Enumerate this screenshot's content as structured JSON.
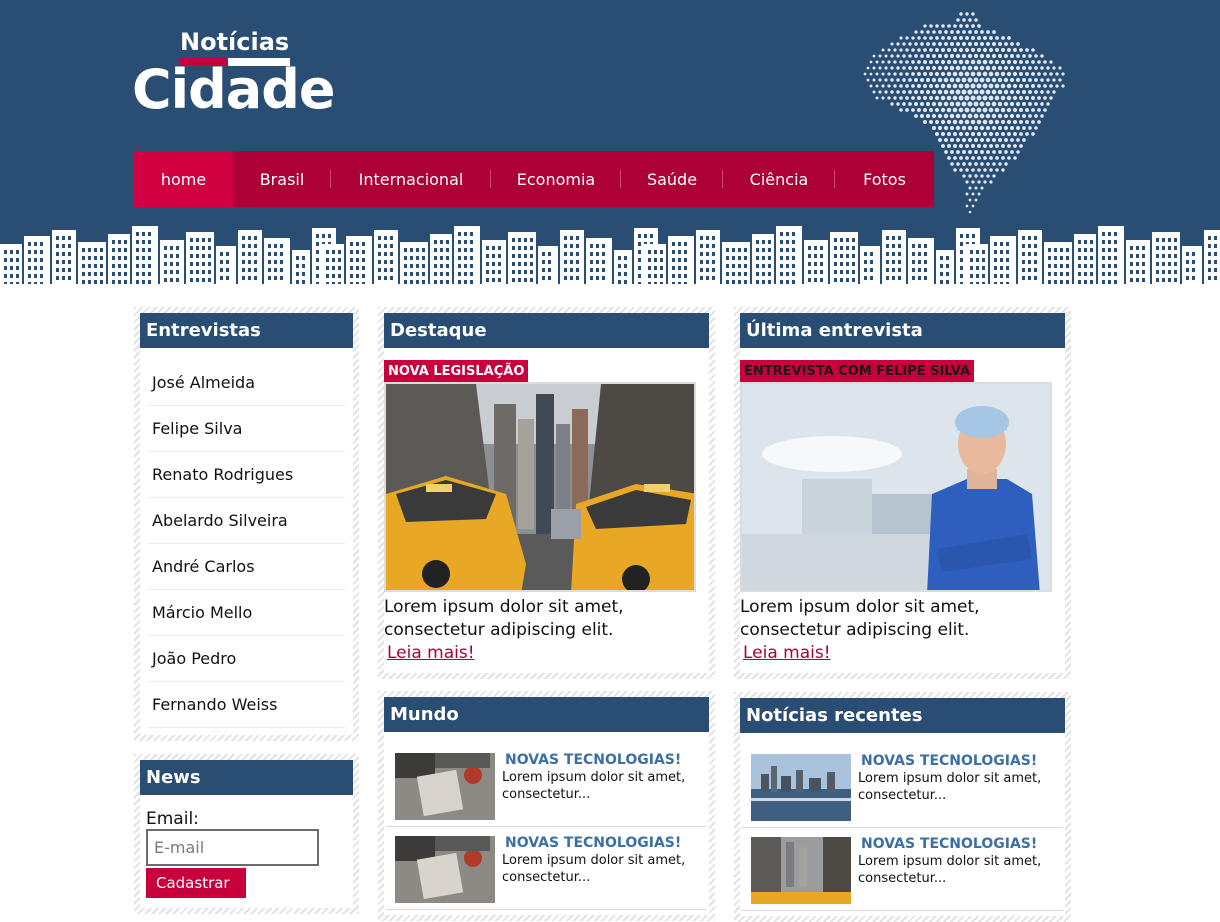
{
  "logo": {
    "top": "Notícias",
    "main": "Cidade"
  },
  "nav": [
    {
      "label": "home",
      "active": true
    },
    {
      "label": "Brasil"
    },
    {
      "label": "Internacional"
    },
    {
      "label": "Economia"
    },
    {
      "label": "Saúde"
    },
    {
      "label": "Ciência"
    },
    {
      "label": "Fotos"
    }
  ],
  "interviews": {
    "title": "Entrevistas",
    "items": [
      "José Almeida",
      "Felipe Silva",
      "Renato Rodrigues",
      "Abelardo Silveira",
      "André Carlos",
      "Márcio Mello",
      "João Pedro",
      "Fernando Weiss"
    ]
  },
  "newsletter": {
    "title": "News",
    "email_label": "Email:",
    "email_placeholder": "E-mail",
    "button_label": "Cadastrar"
  },
  "featured": {
    "title": "Destaque",
    "tag": "NOVA LEGISLAÇÃO",
    "text": "Lorem ipsum dolor sit amet, consectetur adipiscing elit.",
    "link": "Leia mais!"
  },
  "last_interview": {
    "title": "Última entrevista",
    "tag": "ENTREVISTA COM FELIPE SILVA",
    "text": "Lorem ipsum dolor sit amet, consectetur adipiscing elit.",
    "link": "Leia mais!"
  },
  "world": {
    "title": "Mundo",
    "items": [
      {
        "title": "NOVAS TECNOLOGIAS!",
        "text": "Lorem ipsum dolor sit amet, consectetur..."
      },
      {
        "title": "NOVAS TECNOLOGIAS!",
        "text": "Lorem ipsum dolor sit amet, consectetur..."
      }
    ]
  },
  "recent": {
    "title": "Notícias recentes",
    "items": [
      {
        "title": "NOVAS TECNOLOGIAS!",
        "text": "Lorem ipsum dolor sit amet, consectetur..."
      },
      {
        "title": "NOVAS TECNOLOGIAS!",
        "text": "Lorem ipsum dolor sit amet, consectetur..."
      }
    ]
  },
  "colors": {
    "header": "#2a4d73",
    "nav": "#ad0036",
    "nav_active": "#d10040",
    "accent": "#c8003c",
    "link_blue": "#3c6fa3"
  }
}
